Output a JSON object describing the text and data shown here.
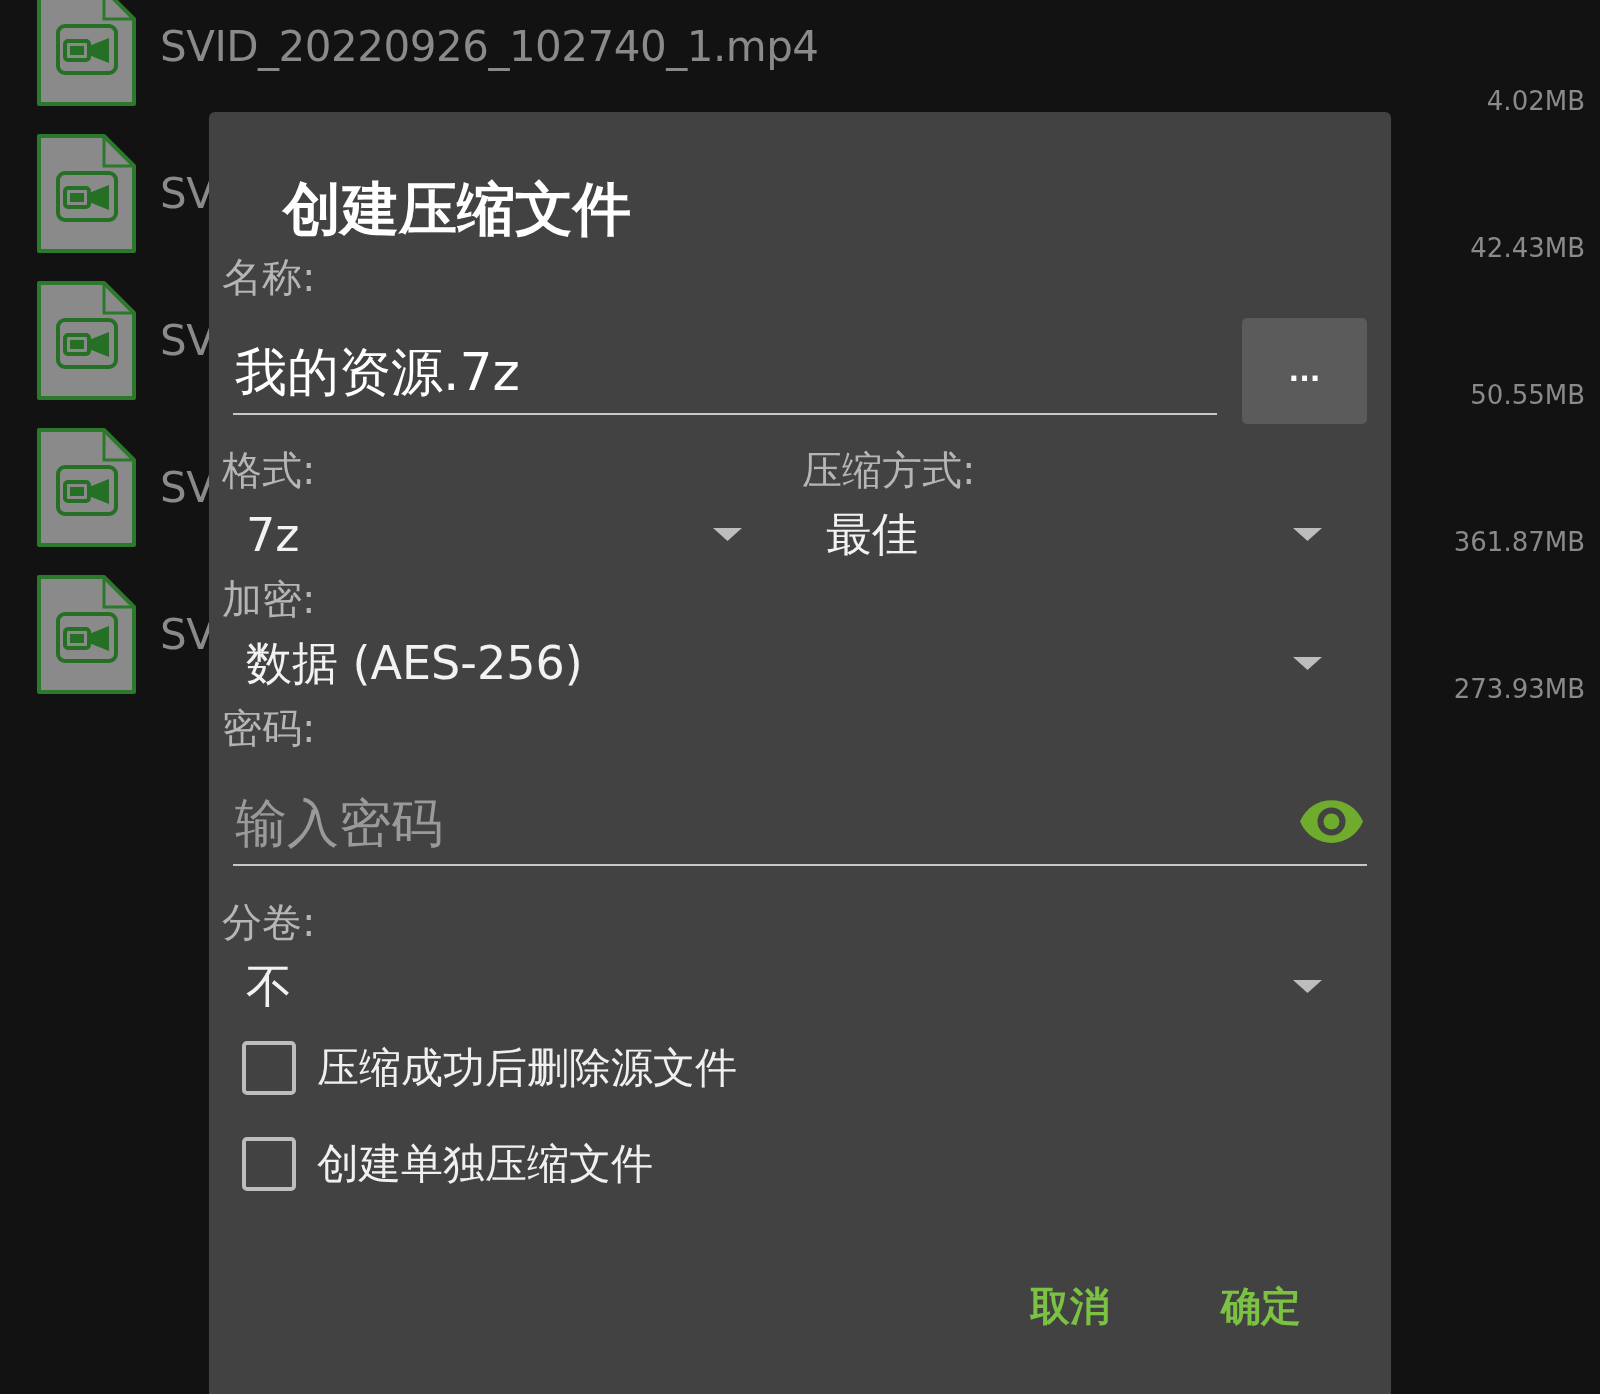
{
  "files": [
    {
      "name": "SVID_20220926_102740_1.mp4",
      "size": "4.02MB"
    },
    {
      "name": "SV",
      "size": "42.43MB"
    },
    {
      "name": "SV",
      "size": "50.55MB"
    },
    {
      "name": "SV",
      "size": "361.87MB"
    },
    {
      "name": "SV",
      "size": "273.93MB"
    }
  ],
  "dialog": {
    "title": "创建压缩文件",
    "name": {
      "label": "名称:",
      "value": "我的资源.7z",
      "button": "..."
    },
    "format": {
      "label": "格式:",
      "value": "7z"
    },
    "method": {
      "label": "压缩方式:",
      "value": "最佳"
    },
    "encryption": {
      "label": "加密:",
      "value": "数据 (AES-256)"
    },
    "password": {
      "label": "密码:",
      "placeholder": "输入密码"
    },
    "split": {
      "label": "分卷:",
      "value": "不"
    },
    "options": [
      {
        "label": "压缩成功后删除源文件",
        "checked": false
      },
      {
        "label": "创建单独压缩文件",
        "checked": false
      }
    ],
    "buttons": [
      "取消",
      "确定"
    ]
  }
}
